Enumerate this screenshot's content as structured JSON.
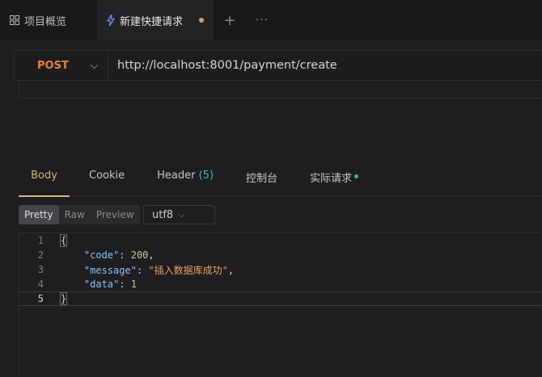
{
  "tabs": {
    "overview_label": "项目概览",
    "active_label": "新建快捷请求",
    "plus": "+",
    "more": "···"
  },
  "request": {
    "method": "POST",
    "url": "http://localhost:8001/payment/create"
  },
  "response_tabs": {
    "body": "Body",
    "cookie": "Cookie",
    "header": "Header",
    "header_count": "(5)",
    "console": "控制台",
    "actual_request": "实际请求"
  },
  "format": {
    "pretty": "Pretty",
    "raw": "Raw",
    "preview": "Preview",
    "encoding": "utf8"
  },
  "code": {
    "line_numbers": [
      "1",
      "2",
      "3",
      "4",
      "5"
    ],
    "open_brace": "{",
    "close_brace": "}",
    "k_code": "\"code\"",
    "v_code": "200",
    "k_message": "\"message\"",
    "v_message": "\"插入数据库成功\"",
    "k_data": "\"data\"",
    "v_data": "1"
  },
  "colors": {
    "method": "#e8843d",
    "active_tab": "#d6b67a",
    "key": "#8cc4f0",
    "string": "#e6a26b"
  }
}
